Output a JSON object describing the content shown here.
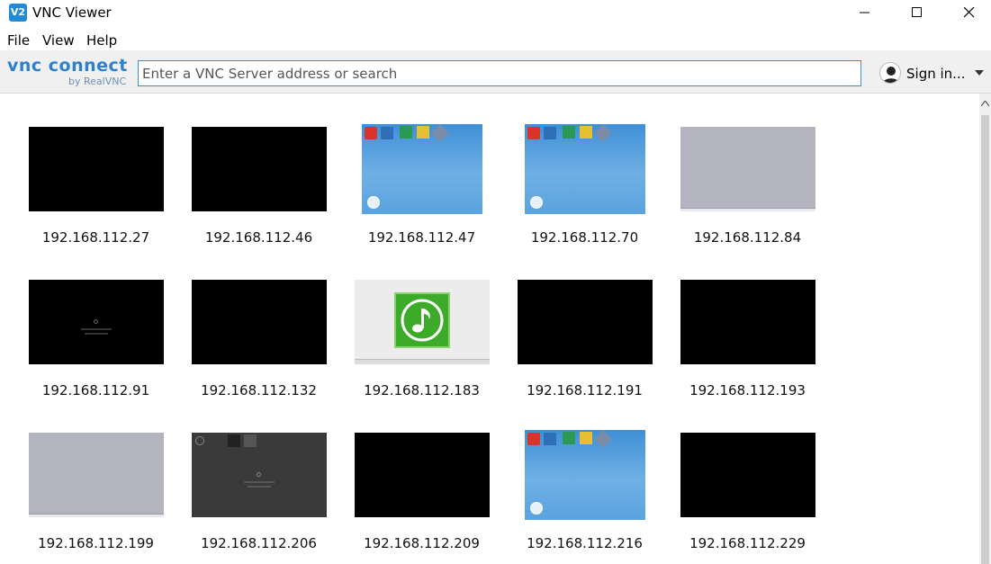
{
  "window": {
    "title": "VNC Viewer",
    "app_icon": "V2"
  },
  "menu": {
    "file": "File",
    "view": "View",
    "help": "Help"
  },
  "toolbar": {
    "brand_main": "vnc connect",
    "brand_sub": "by RealVNC",
    "search_placeholder": "Enter a VNC Server address or search",
    "signin_label": "Sign in..."
  },
  "colors": {
    "accent": "#3d8bd6",
    "toolbar_bg": "#f0f0f0"
  },
  "hosts": [
    {
      "label": "192.168.112.27",
      "preview": "black"
    },
    {
      "label": "192.168.112.46",
      "preview": "black"
    },
    {
      "label": "192.168.112.47",
      "preview": "desktop-blue"
    },
    {
      "label": "192.168.112.70",
      "preview": "desktop-blue"
    },
    {
      "label": "192.168.112.84",
      "preview": "grey"
    },
    {
      "label": "192.168.112.91",
      "preview": "black-boot"
    },
    {
      "label": "192.168.112.132",
      "preview": "black"
    },
    {
      "label": "192.168.112.183",
      "preview": "music-app"
    },
    {
      "label": "192.168.112.191",
      "preview": "black"
    },
    {
      "label": "192.168.112.193",
      "preview": "black"
    },
    {
      "label": "192.168.112.199",
      "preview": "grey"
    },
    {
      "label": "192.168.112.206",
      "preview": "dark-desktop"
    },
    {
      "label": "192.168.112.209",
      "preview": "black"
    },
    {
      "label": "192.168.112.216",
      "preview": "desktop-blue"
    },
    {
      "label": "192.168.112.229",
      "preview": "black"
    }
  ]
}
